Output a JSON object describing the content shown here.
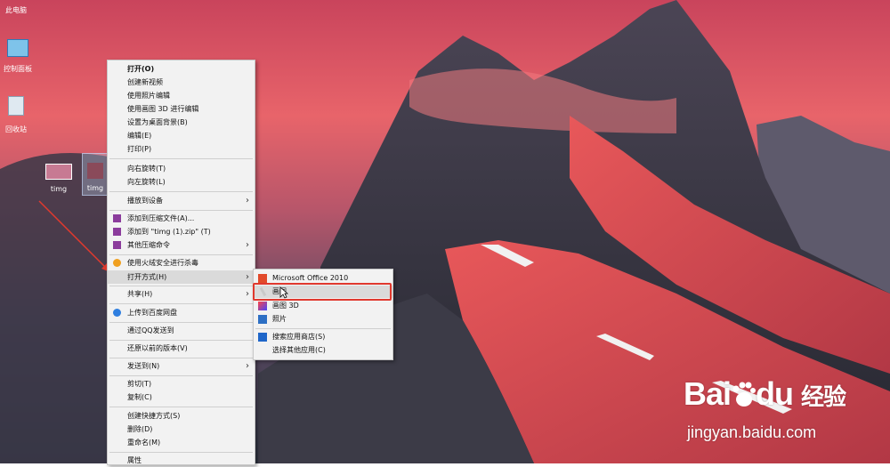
{
  "desktop": {
    "icons": [
      {
        "label": "此电脑"
      },
      {
        "label": "控制面板"
      },
      {
        "label": "回收站"
      },
      {
        "label": "timg"
      },
      {
        "label": "timg"
      }
    ]
  },
  "context_menu": {
    "items": [
      {
        "label": "打开(O)",
        "bold": true
      },
      {
        "label": "创建新视频"
      },
      {
        "label": "使用照片编辑"
      },
      {
        "label": "使用画图 3D 进行编辑"
      },
      {
        "label": "设置为桌面背景(B)"
      },
      {
        "label": "编辑(E)"
      },
      {
        "label": "打印(P)"
      },
      {
        "label": "向右旋转(T)"
      },
      {
        "label": "向左旋转(L)"
      },
      {
        "label": "播放到设备"
      },
      {
        "label": "添加到压缩文件(A)..."
      },
      {
        "label": "添加到 \"timg (1).zip\" (T)"
      },
      {
        "label": "其他压缩命令"
      },
      {
        "label": "使用火绒安全进行杀毒"
      },
      {
        "label": "打开方式(H)"
      },
      {
        "label": "共享(H)"
      },
      {
        "label": "上传到百度网盘"
      },
      {
        "label": "通过QQ发送到"
      },
      {
        "label": "还原以前的版本(V)"
      },
      {
        "label": "发送到(N)"
      },
      {
        "label": "剪切(T)"
      },
      {
        "label": "复制(C)"
      },
      {
        "label": "创建快捷方式(S)"
      },
      {
        "label": "删除(D)"
      },
      {
        "label": "重命名(M)"
      },
      {
        "label": "属性"
      }
    ]
  },
  "open_with_submenu": {
    "items": [
      {
        "label": "Microsoft Office 2010"
      },
      {
        "label": "画图"
      },
      {
        "label": "画图 3D"
      },
      {
        "label": "照片"
      },
      {
        "label": "搜索应用商店(S)"
      },
      {
        "label": "选择其他应用(C)"
      }
    ]
  },
  "watermark": {
    "brand_latin": "Bai",
    "brand_suffix": "du",
    "brand_cn": "经验",
    "url": "jingyan.baidu.com"
  },
  "colors": {
    "annotation_red": "#e0392e",
    "menu_bg": "#f2f2f2"
  }
}
